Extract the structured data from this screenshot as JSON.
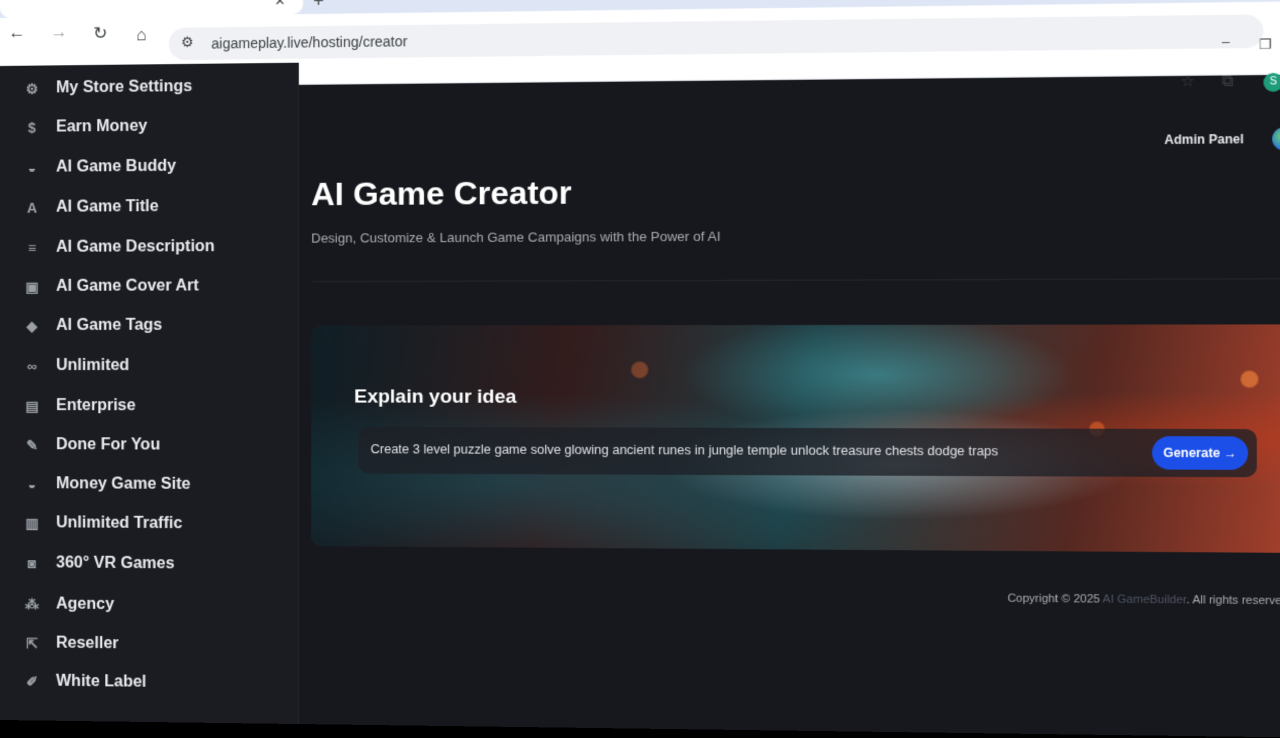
{
  "browser": {
    "url": "aigameplay.live/hosting/creator",
    "profile_initial": "S",
    "icons": {
      "back": "←",
      "forward": "→",
      "reload": "↻",
      "home": "⌂",
      "site_info": "⚙",
      "star": "☆",
      "extensions": "⧉",
      "menu": "⋮",
      "minimize": "–",
      "restore": "❐",
      "close": "✕",
      "tab_close": "✕",
      "new_tab": "+"
    }
  },
  "sidebar": {
    "items": [
      {
        "label": "My Store Settings",
        "icon": "⚙"
      },
      {
        "label": "Earn Money",
        "icon": "$"
      },
      {
        "label": "AI Game Buddy",
        "icon": "◒"
      },
      {
        "label": "AI Game Title",
        "icon": "A"
      },
      {
        "label": "AI Game Description",
        "icon": "≡"
      },
      {
        "label": "AI Game Cover Art",
        "icon": "▣"
      },
      {
        "label": "AI Game Tags",
        "icon": "◆"
      },
      {
        "label": "Unlimited",
        "icon": "∞"
      },
      {
        "label": "Enterprise",
        "icon": "▤"
      },
      {
        "label": "Done For You",
        "icon": "✎"
      },
      {
        "label": "Money Game Site",
        "icon": "◒"
      },
      {
        "label": "Unlimited Traffic",
        "icon": "▥"
      },
      {
        "label": "360° VR Games",
        "icon": "◙"
      },
      {
        "label": "Agency",
        "icon": "⁂"
      },
      {
        "label": "Reseller",
        "icon": "⇱"
      },
      {
        "label": "White Label",
        "icon": "✐"
      }
    ]
  },
  "header": {
    "admin_label": "Admin Panel"
  },
  "main": {
    "title": "AI Game Creator",
    "subtitle": "Design, Customize & Launch Game Campaigns with the Power of AI",
    "hero": {
      "label": "Explain your idea",
      "prompt_value": "Create 3 level puzzle game solve glowing ancient runes in jungle temple unlock treasure chests dodge traps",
      "generate_label": "Generate →"
    }
  },
  "footer": {
    "copyright_prefix": "Copyright © 2025",
    "brand": "AI GameBuilder",
    "rights": ". All rights reserved."
  }
}
